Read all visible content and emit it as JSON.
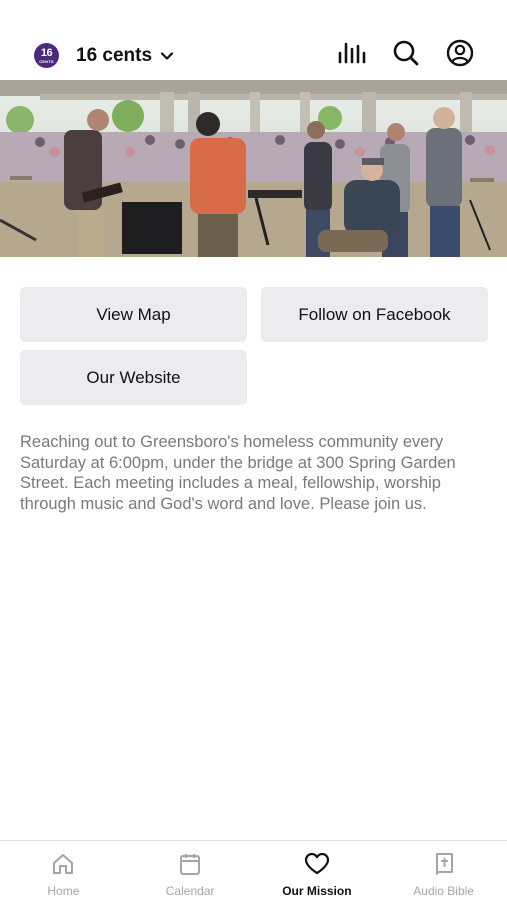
{
  "header": {
    "logo_text": "16",
    "logo_subtext": "CENTS",
    "title": "16 cents",
    "icons": [
      "chevron-down-icon",
      "audio-bars-icon",
      "search-icon",
      "account-icon"
    ]
  },
  "buttons": {
    "view_map": "View Map",
    "follow_facebook": "Follow on Facebook",
    "our_website": "Our Website"
  },
  "description": "Reaching out to Greensboro's homeless community every Saturday at 6:00pm, under the bridge at 300 Spring Garden Street. Each meeting includes a meal, fellowship, worship through music and God's word and love. Please join us.",
  "tabs": [
    {
      "label": "Home",
      "icon": "home-icon",
      "active": false
    },
    {
      "label": "Calendar",
      "icon": "calendar-icon",
      "active": false
    },
    {
      "label": "Our Mission",
      "icon": "heart-icon",
      "active": true
    },
    {
      "label": "Audio Bible",
      "icon": "bible-icon",
      "active": false
    }
  ],
  "colors": {
    "logo": "#4a2a7a",
    "button_bg": "#ececee",
    "description_text": "#7a7a7a",
    "tab_inactive": "#a5a5a5",
    "tab_active": "#111111"
  }
}
